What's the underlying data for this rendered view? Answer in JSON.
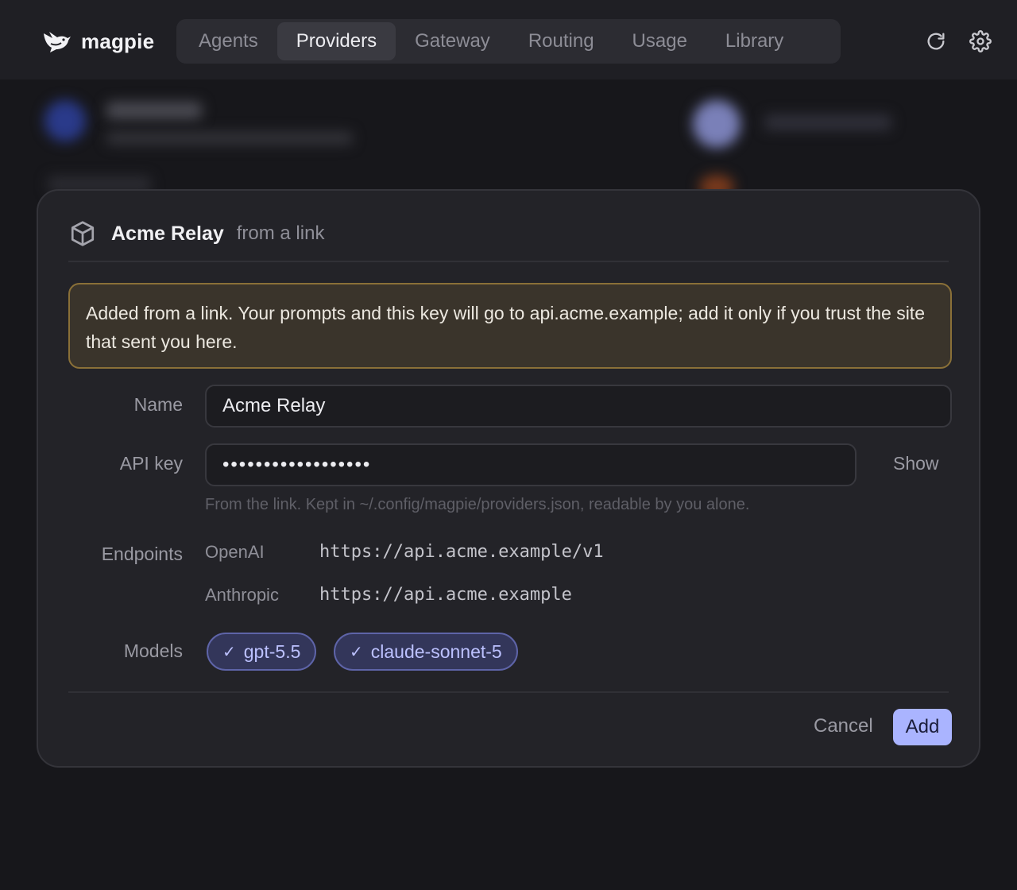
{
  "app": {
    "name": "magpie"
  },
  "nav": {
    "tabs": [
      {
        "label": "Agents",
        "active": false
      },
      {
        "label": "Providers",
        "active": true
      },
      {
        "label": "Gateway",
        "active": false
      },
      {
        "label": "Routing",
        "active": false
      },
      {
        "label": "Usage",
        "active": false
      },
      {
        "label": "Library",
        "active": false
      }
    ],
    "icons": [
      "refresh-icon",
      "gear-icon"
    ]
  },
  "modal": {
    "icon": "cube-icon",
    "title": "Acme Relay",
    "subtitle": "from a link",
    "warning": "Added from a link. Your prompts and this key will go to api.acme.example; add it only if you trust the site that sent you here.",
    "name": {
      "label": "Name",
      "value": "Acme Relay"
    },
    "api_key": {
      "label": "API key",
      "masked_value": "••••••••••••••••••",
      "show_label": "Show",
      "hint": "From the link. Kept in ~/.config/magpie/providers.json, readable by you alone."
    },
    "endpoints": {
      "label": "Endpoints",
      "items": [
        {
          "name": "OpenAI",
          "url": "https://api.acme.example/v1"
        },
        {
          "name": "Anthropic",
          "url": "https://api.acme.example"
        }
      ]
    },
    "models": {
      "label": "Models",
      "items": [
        {
          "name": "gpt-5.5",
          "checked": true
        },
        {
          "name": "claude-sonnet-5",
          "checked": true
        }
      ]
    },
    "cancel_label": "Cancel",
    "add_label": "Add"
  },
  "colors": {
    "background": "#17171b",
    "accent": "#aab4ff",
    "warning_border": "#8a7038",
    "chip_border": "#5e64a8"
  }
}
